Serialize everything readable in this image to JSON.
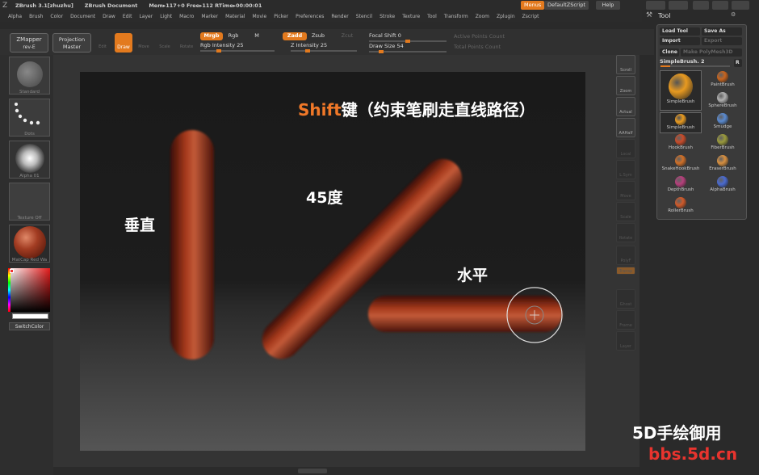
{
  "titlebar": {
    "logo": "Z",
    "app": "ZBrush  3.1[zhuzhu]",
    "document": "ZBrush Document",
    "mem": "Mem▸117+0  Free▸112  RTime▸00:00:01",
    "menus_btn": "Menus",
    "script_btn": "DefaultZScript",
    "help_btn": "Help"
  },
  "menubar": [
    "Alpha",
    "Brush",
    "Color",
    "Document",
    "Draw",
    "Edit",
    "Layer",
    "Light",
    "Macro",
    "Marker",
    "Material",
    "Movie",
    "Picker",
    "Preferences",
    "Render",
    "Stencil",
    "Stroke",
    "Texture",
    "Tool",
    "Transform",
    "Zoom",
    "Zplugin",
    "Zscript"
  ],
  "toolbar": {
    "zmapper": "ZMapper",
    "zmapper_sub": "rev-E",
    "projection": "Projection",
    "projection_sub": "Master",
    "edit": "Edit",
    "draw": "Draw",
    "move": "Move",
    "scale": "Scale",
    "rotate": "Rotate",
    "mrgb": "Mrgb",
    "rgb": "Rgb",
    "m": "M",
    "zadd": "Zadd",
    "zsub": "Zsub",
    "zcut": "Zcut",
    "rgb_intensity": "Rgb  Intensity 25",
    "z_intensity": "Z  Intensity 25",
    "focal_shift": "Focal Shift 0",
    "draw_size": "Draw Size 54",
    "active_points": "Active Points Count",
    "total_points": "Total Points Count"
  },
  "leftshelf": {
    "standard": "Standard",
    "dots": "Dots",
    "alpha": "Alpha 01",
    "texture": "Texture Off",
    "matcap": "MatCap Red Wa",
    "switch_color": "SwitchColor"
  },
  "rightshelf": [
    "Scroll",
    "Zoom",
    "Actual",
    "AAHalf",
    "Local",
    "L.Sym",
    "Move",
    "Scale",
    "Rotate",
    "PolyF",
    "Transp",
    "Ghost",
    "Frame",
    "Layer"
  ],
  "toolpanel": {
    "title": "Tool",
    "load": "Load Tool",
    "save": "Save As",
    "import": "Import",
    "export": "Export",
    "clone": "Clone",
    "make": "Make PolyMesh3D",
    "current": "SimpleBrush. 2",
    "r": "R",
    "brushes": [
      {
        "name": "SimpleBrush",
        "icon": "simplebrush-icon",
        "color": "#e89a20"
      },
      {
        "name": "PaintBrush",
        "icon": "paintbrush-icon",
        "color": "#c8641e"
      },
      {
        "name": "SimpleBrush",
        "icon": "simplebrush-small-icon",
        "color": "#e89a20"
      },
      {
        "name": "SphereBrush",
        "icon": "spherebrush-icon",
        "color": "#b0b0b0"
      },
      {
        "name": "Smudge",
        "icon": "smudge-icon",
        "color": "#5a8ad0"
      },
      {
        "name": "HookBrush",
        "icon": "hookbrush-icon",
        "color": "#c84c2a"
      },
      {
        "name": "FiberBrush",
        "icon": "fiberbrush-icon",
        "color": "#9a9a3c"
      },
      {
        "name": "SnakeHookBrush",
        "icon": "snakehook-icon",
        "color": "#d07028"
      },
      {
        "name": "EraserBrush",
        "icon": "eraserbrush-icon",
        "color": "#d89040"
      },
      {
        "name": "DepthBrush",
        "icon": "depthbrush-icon",
        "color": "#b6407c"
      },
      {
        "name": "AlphaBrush",
        "icon": "alphabrush-icon",
        "color": "#4a6ad0"
      },
      {
        "name": "RollerBrush",
        "icon": "rollerbrush-icon",
        "color": "#d05a2a"
      }
    ]
  },
  "canvas": {
    "shift_part": "Shift",
    "shift_rest": "键（约束笔刷走直线路径）",
    "vertical": "垂直",
    "diag45": "45度",
    "horizontal": "水平"
  },
  "watermark": {
    "line1": "5D手绘御用",
    "line2": "bbs.5d.cn"
  },
  "colors": {
    "accent": "#e37a1e",
    "stroke": "#8a2c14",
    "watermark_red": "#e8342e"
  }
}
